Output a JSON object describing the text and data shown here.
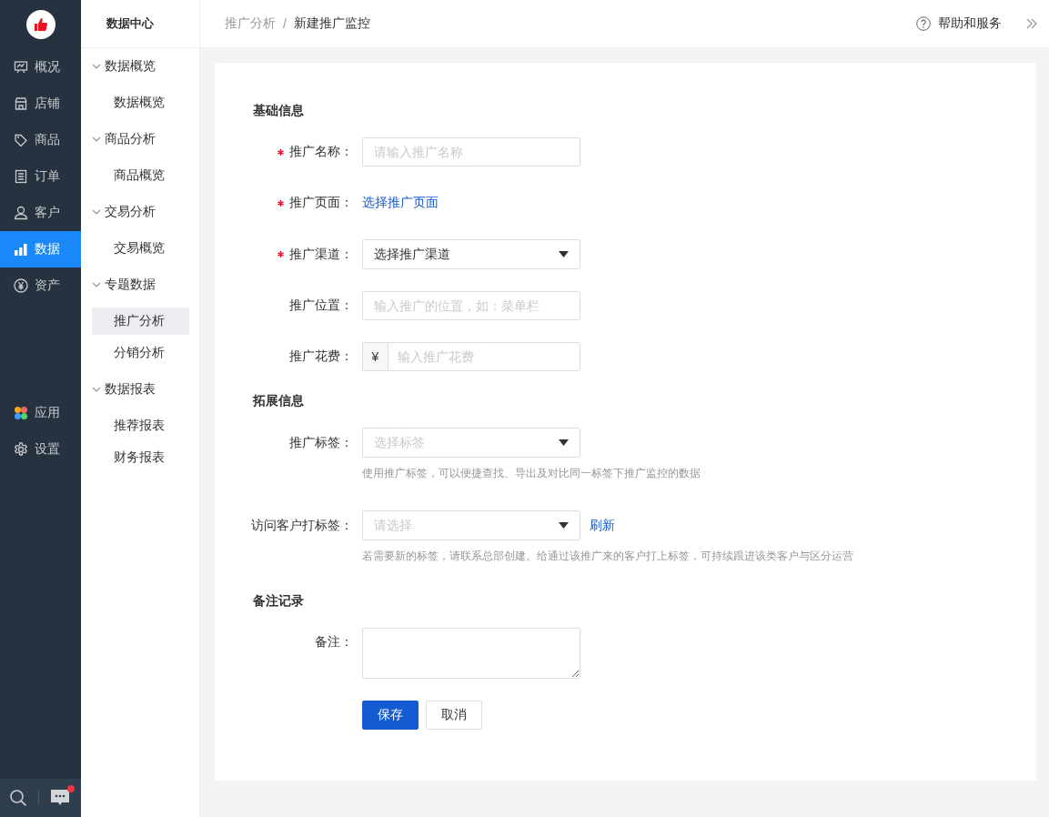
{
  "main_nav": {
    "top_items": [
      {
        "label": "概况",
        "selected": false
      },
      {
        "label": "店铺",
        "selected": false
      },
      {
        "label": "商品",
        "selected": false
      },
      {
        "label": "订单",
        "selected": false
      },
      {
        "label": "客户",
        "selected": false
      },
      {
        "label": "数据",
        "selected": true
      },
      {
        "label": "资产",
        "selected": false
      }
    ],
    "bottom_items": [
      {
        "label": "应用",
        "selected": false
      },
      {
        "label": "设置",
        "selected": false
      }
    ]
  },
  "sub_nav": {
    "title": "数据中心",
    "groups": [
      {
        "label": "数据概览",
        "expanded": true,
        "children": [
          {
            "label": "数据概览",
            "selected": false
          }
        ]
      },
      {
        "label": "商品分析",
        "expanded": true,
        "children": [
          {
            "label": "商品概览",
            "selected": false
          }
        ]
      },
      {
        "label": "交易分析",
        "expanded": true,
        "children": [
          {
            "label": "交易概览",
            "selected": false
          }
        ]
      },
      {
        "label": "专题数据",
        "expanded": true,
        "children": [
          {
            "label": "推广分析",
            "selected": true
          },
          {
            "label": "分销分析",
            "selected": false
          }
        ]
      },
      {
        "label": "数据报表",
        "expanded": true,
        "children": [
          {
            "label": "推荐报表",
            "selected": false
          },
          {
            "label": "财务报表",
            "selected": false
          }
        ]
      }
    ]
  },
  "breadcrumb": {
    "separator": "/",
    "items": [
      {
        "label": "推广分析",
        "current": false
      },
      {
        "label": "新建推广监控",
        "current": true
      }
    ]
  },
  "help": {
    "label": "帮助和服务"
  },
  "form": {
    "sections": [
      {
        "title": "基础信息",
        "fields": [
          {
            "kind": "input",
            "label": "推广名称：",
            "required": true,
            "placeholder": "请输入推广名称"
          },
          {
            "kind": "link",
            "label": "推广页面：",
            "required": true,
            "link": "选择推广页面"
          },
          {
            "kind": "select",
            "label": "推广渠道：",
            "required": true,
            "value": "选择推广渠道"
          },
          {
            "kind": "input",
            "label": "推广位置：",
            "required": false,
            "placeholder": "输入推广的位置，如：菜单栏"
          },
          {
            "kind": "prefixed",
            "label": "推广花费：",
            "required": false,
            "prefix": "¥",
            "placeholder": "输入推广花费"
          }
        ]
      },
      {
        "title": "拓展信息",
        "fields": [
          {
            "kind": "select",
            "label": "推广标签：",
            "required": false,
            "placeholder": "选择标签",
            "hint": "使用推广标签，可以便捷查找、导出及对比同一标签下推广监控的数据"
          },
          {
            "kind": "select",
            "label": "访问客户打标签：",
            "required": false,
            "placeholder": "请选择",
            "action": "刷新",
            "hint": "若需要新的标签，请联系总部创建。给通过该推广来的客户打上标签，可持续跟进该类客户与区分运营"
          }
        ]
      },
      {
        "title": "备注记录",
        "fields": [
          {
            "kind": "textarea",
            "label": "备注：",
            "required": false
          }
        ]
      }
    ],
    "buttons": [
      {
        "label": "保存",
        "kind": "primary"
      },
      {
        "label": "取消",
        "kind": "default"
      }
    ]
  }
}
